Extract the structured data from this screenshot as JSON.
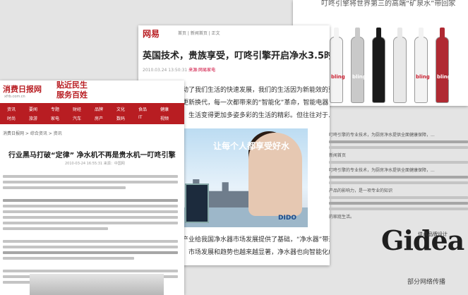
{
  "back_page": {
    "headline": "叮咚引擎将世界第三的高端“矿泉水”带回家",
    "bottles": [
      {
        "label": "bling",
        "color": "#f3f3f3"
      },
      {
        "label": "bling",
        "color": "#c9c9c9"
      },
      {
        "label": "",
        "color": "#1a1a1a"
      },
      {
        "label": "",
        "color": "#e8e8e8"
      },
      {
        "label": "bling",
        "color": "#f2f2f2"
      },
      {
        "label": "bling",
        "color": "#b02a33"
      }
    ]
  },
  "middle_page": {
    "logo": "网易",
    "breadcrumb": "首页 | 新闻首页 | 正文",
    "headline": "英国技术，贵族享受，叮咚引擎开启净水3.5时代",
    "meta_date": "2010.03.24 13:50:31",
    "meta_source": "来源:网易家电",
    "body_lines": [
      "动了我们生活的快速发展，我们的生活因为新能效的更加便利，",
      "更新换代，每一次都带来的“智能化”革命，智能电器，智能",
      "，生活变得更加多姿多彩的生活的精彩。但往往对于..."
    ],
    "ad_slogan": "让每个人都享受好水",
    "ad_brand": "DIDO",
    "footer_lines": [
      "产业给我国净水器市场发展提供了基础，“净水器”带来的新的",
      "，市场发展和趋势也越来越显著，净水器也向智能化成为"
    ]
  },
  "right_text": {
    "lines": [
      "叮咚引擎的专业技术，为厨房净水提供全面健康保障，...",
      "新闻首页",
      "叮咚引擎的专业技术，为厨房净水提供全面健康保障，...",
      "产品的影响力，是一项专业的知识",
      "的家庭生活。"
    ]
  },
  "front_page": {
    "logo": "消费日报网",
    "url": "xfrb.com.cn",
    "slogan_line1": "贴近民生",
    "slogan_line2": "服务百姓",
    "nav_row1": [
      "资讯",
      "要闻",
      "专题",
      "财经",
      "品牌",
      "文化",
      "食品",
      "健康"
    ],
    "nav_row2": [
      "时尚",
      "旅游",
      "家电",
      "汽车",
      "房产",
      "数码",
      "IT",
      "视频"
    ],
    "breadcrumb": "消费日报网 > 综合资讯 > 资讯",
    "headline": "行业黑马打破“定律”  净水机不再是贵水机一叮咚引擎",
    "meta": "2010-03-24 16:55:31  来源：中国网"
  },
  "brand": {
    "logo": "Gidea",
    "tagline": "佳点品牌设计",
    "caption": "部分网络传播"
  }
}
